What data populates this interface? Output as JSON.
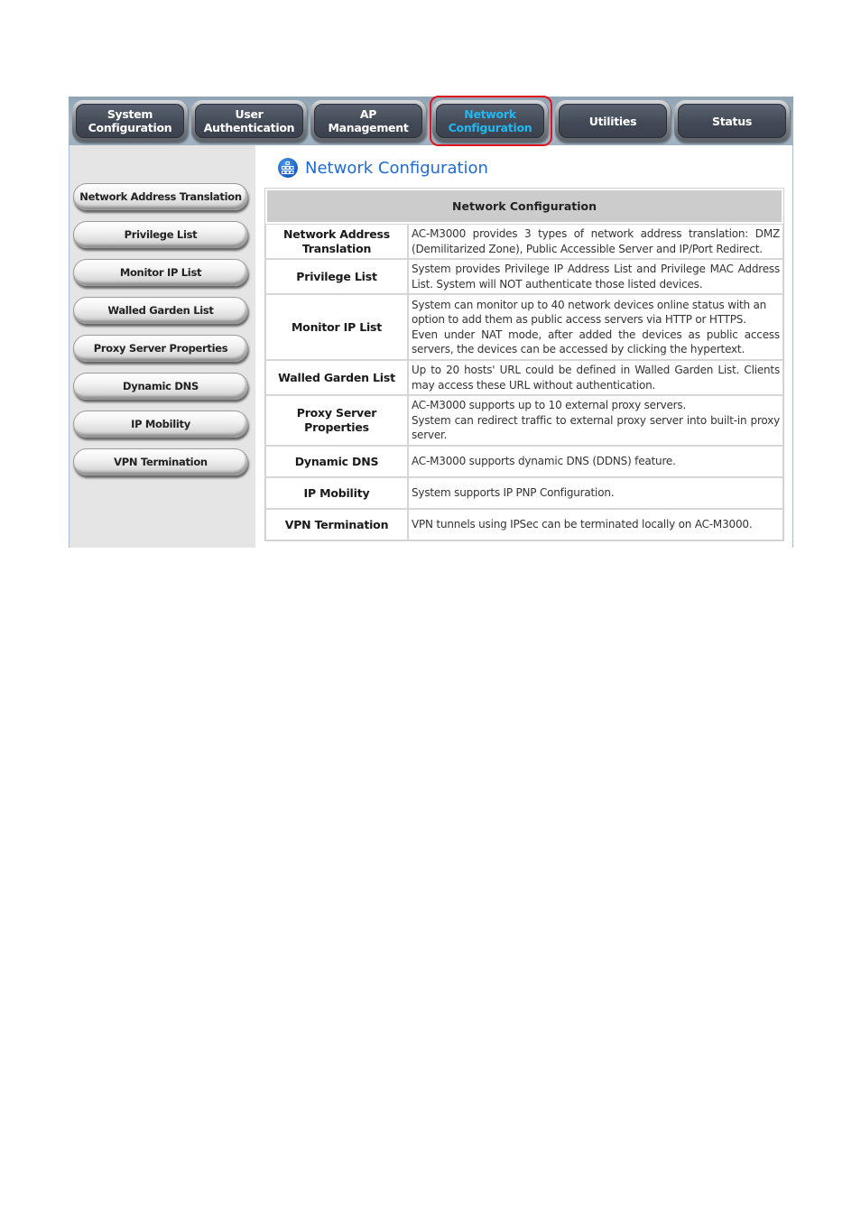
{
  "top_nav": {
    "tabs": [
      {
        "label": "System\nConfiguration",
        "active": false
      },
      {
        "label": "User\nAuthentication",
        "active": false
      },
      {
        "label": "AP\nManagement",
        "active": false
      },
      {
        "label": "Network\nConfiguration",
        "active": true
      },
      {
        "label": "Utilities",
        "active": false
      },
      {
        "label": "Status",
        "active": false
      }
    ],
    "active_color": "#1fb8f2",
    "highlight_color": "#e0141e"
  },
  "sidebar": {
    "items": [
      {
        "label": "Network Address Translation"
      },
      {
        "label": "Privilege List"
      },
      {
        "label": "Monitor IP List"
      },
      {
        "label": "Walled Garden List"
      },
      {
        "label": "Proxy Server Properties"
      },
      {
        "label": "Dynamic DNS"
      },
      {
        "label": "IP Mobility"
      },
      {
        "label": "VPN Termination"
      }
    ]
  },
  "page": {
    "title": "Network Configuration",
    "title_icon": "network-grid-icon",
    "title_color": "#1e6ad6"
  },
  "table": {
    "header": "Network Configuration",
    "rows": [
      {
        "name": "Network Address Translation",
        "desc": [
          "AC-M3000 provides 3 types of network address translation: DMZ (Demilitarized Zone), Public Accessible Server and IP/Port Redirect."
        ]
      },
      {
        "name": "Privilege List",
        "desc": [
          "System provides Privilege IP Address List and Privilege MAC Address List. System will NOT authenticate those listed devices."
        ]
      },
      {
        "name": "Monitor IP List",
        "desc": [
          "System can monitor up to 40 network devices online status with an option to add them as public access servers via HTTP or HTTPS.",
          "Even under NAT mode, after added the devices as public access servers, the devices can be accessed by clicking the hypertext."
        ]
      },
      {
        "name": "Walled Garden List",
        "desc": [
          "Up to 20 hosts' URL could be defined in Walled Garden List. Clients may access these URL without authentication."
        ]
      },
      {
        "name": "Proxy Server Properties",
        "desc": [
          "AC-M3000 supports up to 10 external proxy servers.",
          "System can redirect traffic to external proxy server into built-in proxy server."
        ]
      },
      {
        "name": "Dynamic DNS",
        "desc": [
          "AC-M3000 supports dynamic DNS (DDNS) feature."
        ]
      },
      {
        "name": "IP Mobility",
        "desc": [
          "System supports IP PNP Configuration."
        ]
      },
      {
        "name": "VPN Termination",
        "desc": [
          "VPN tunnels using IPSec can be terminated locally on AC-M3000."
        ]
      }
    ]
  }
}
